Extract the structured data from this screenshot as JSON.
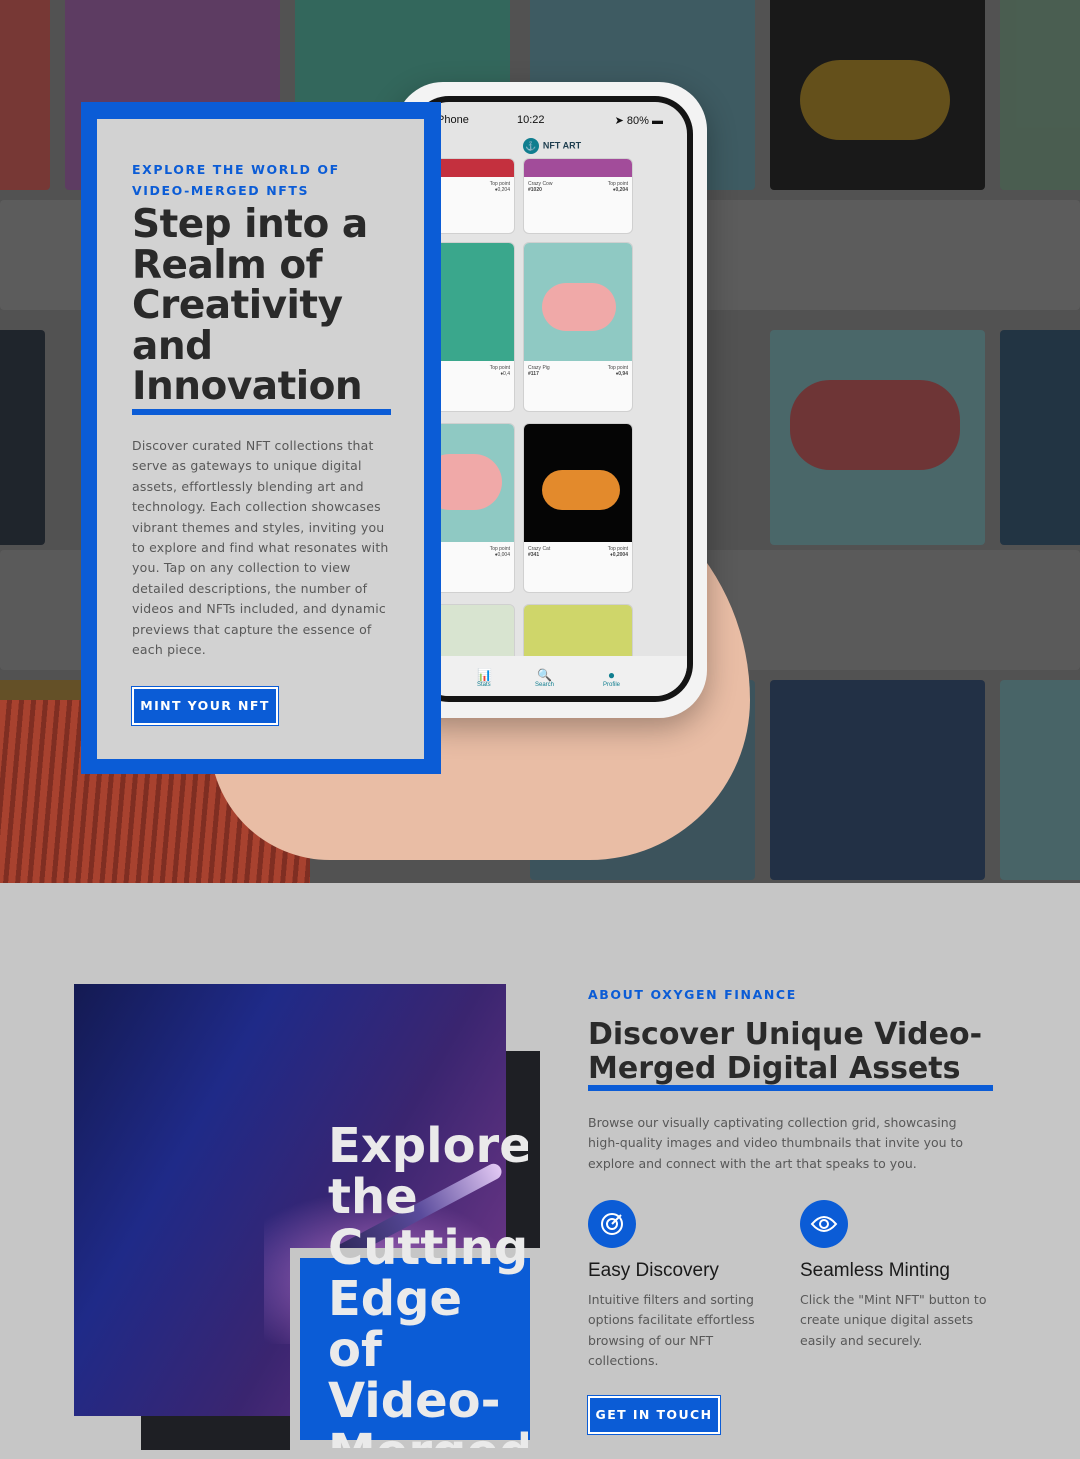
{
  "hero": {
    "eyebrow": "EXPLORE THE WORLD OF VIDEO-MERGED NFTS",
    "title": "Step into a Realm of Creativity and Innovation",
    "description": "Discover curated NFT collections that serve as gateways to unique digital assets, effortlessly blending art and technology. Each collection showcases vibrant themes and styles, inviting you to explore and find what resonates with you. Tap on any collection to view detailed descriptions, the number of videos and NFTs included, and dynamic previews that capture the essence of each piece.",
    "button": "MINT YOUR NFT"
  },
  "phone": {
    "carrier": "Phone",
    "time": "10:22",
    "battery": "80%",
    "app_name": "NFT ART",
    "cards": [
      {
        "name": "Crazy Cow",
        "id": "#1020",
        "label": "Top point",
        "value": "0,204"
      },
      {
        "name": "Crazy Pig",
        "id": "#117",
        "label": "Top point",
        "value": "0,94"
      },
      {
        "name": "Crazy Cat",
        "id": "#341",
        "label": "Top point",
        "value": "0,2004"
      }
    ],
    "tabs": [
      "Stats",
      "Search",
      "Profile"
    ]
  },
  "about": {
    "eyebrow": "ABOUT OXYGEN FINANCE",
    "title": "Discover Unique Video-Merged Digital Assets",
    "description": "Browse our visually captivating collection grid, showcasing high-quality images and video thumbnails that invite you to explore and connect with the art that speaks to you.",
    "image_caption": "Explore the Cutting-Edge of Video-Merged NFTs",
    "features": [
      {
        "icon": "target-icon",
        "title": "Easy Discovery",
        "text": "Intuitive filters and sorting options facilitate effortless browsing of our NFT collections."
      },
      {
        "icon": "eye-icon",
        "title": "Seamless Minting",
        "text": "Click the \"Mint NFT\" button to create unique digital assets easily and securely."
      }
    ],
    "button": "GET IN TOUCH"
  },
  "colors": {
    "accent": "#0b5cd6",
    "background": "#c6c6c6",
    "text": "#2a2a2a"
  }
}
